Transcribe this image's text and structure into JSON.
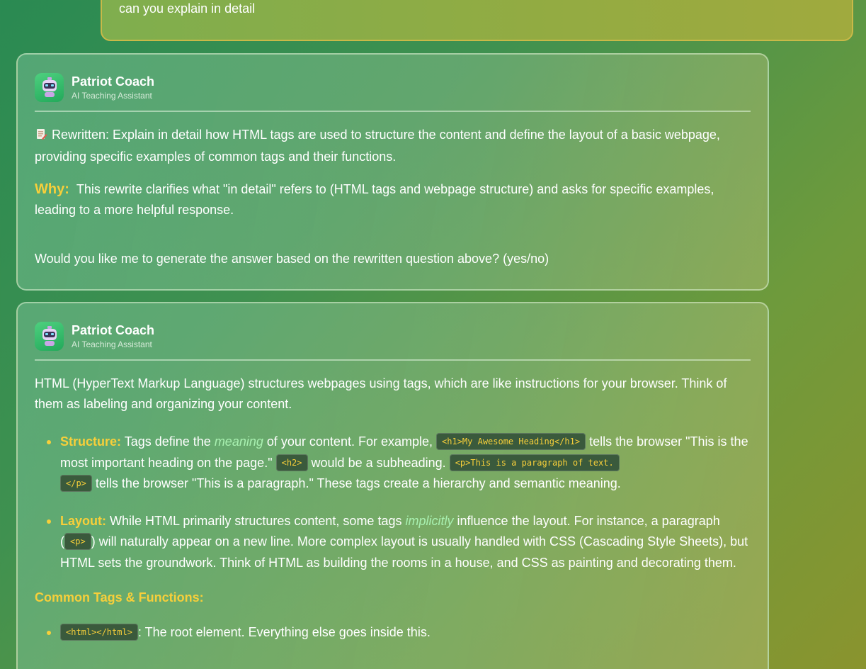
{
  "user_message": {
    "text": "can you explain in detail"
  },
  "messages": [
    {
      "sender": "Patriot Coach",
      "role": "AI Teaching Assistant",
      "rewritten_icon": "memo-icon",
      "rewritten": "Rewritten: Explain in detail how HTML tags are used to structure the content and define the layout of a basic webpage, providing specific examples of common tags and their functions.",
      "why_label": "Why:",
      "why_text": "This rewrite clarifies what \"in detail\" refers to (HTML tags and webpage structure) and asks for specific examples, leading to a more helpful response.",
      "prompt": "Would you like me to generate the answer based on the rewritten question above? (yes/no)"
    },
    {
      "sender": "Patriot Coach",
      "role": "AI Teaching Assistant",
      "intro": "HTML (HyperText Markup Language) structures webpages using tags, which are like instructions for your browser. Think of them as labeling and organizing your content.",
      "structure": {
        "label": "Structure:",
        "t1": "Tags define the",
        "em": "meaning",
        "t2": "of your content. For example,",
        "code1": "<h1>My Awesome Heading</h1>",
        "t3": "tells the browser \"This is the most important heading on the page.\"",
        "code2": "<h2>",
        "t4": "would be a subheading.",
        "code3a": "<p>This is a paragraph of text.",
        "code3b": "</p>",
        "t5": "tells the browser \"This is a paragraph.\" These tags create a hierarchy and semantic meaning."
      },
      "layout": {
        "label": "Layout:",
        "t1": "While HTML primarily structures content, some tags",
        "em": "implicitly",
        "t2": "influence the layout. For instance, a paragraph (",
        "code1": "<p>",
        "t3": ") will naturally appear on a new line. More complex layout is usually handled with CSS (Cascading Style Sheets), but HTML sets the groundwork. Think of HTML as building the rooms in a house, and CSS as painting and decorating them."
      },
      "common_title": "Common Tags & Functions:",
      "common_tags": [
        {
          "code": "<html></html>",
          "desc": ": The root element. Everything else goes inside this."
        }
      ]
    }
  ],
  "colors": {
    "accent_yellow": "#f7cf3a",
    "emphasis_green": "#a8f0b0",
    "avatar_green": "#22a95a"
  }
}
